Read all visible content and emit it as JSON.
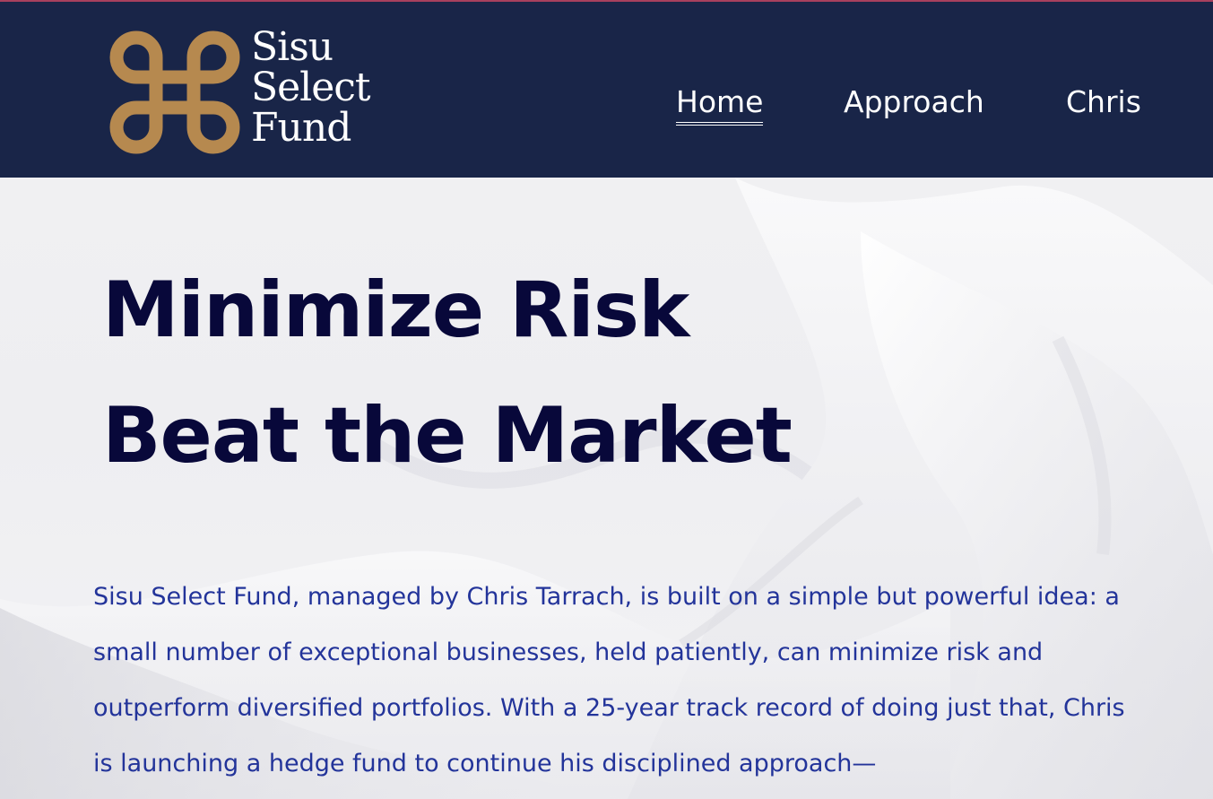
{
  "brand": {
    "name_line1": "Sisu",
    "name_line2": "Select",
    "name_line3": "Fund",
    "logo_color": "#b6894f",
    "header_bg": "#192548"
  },
  "nav": {
    "items": [
      {
        "label": "Home",
        "active": true
      },
      {
        "label": "Approach",
        "active": false
      },
      {
        "label": "Chris",
        "active": false
      }
    ]
  },
  "hero": {
    "headline_line1": "Minimize Risk",
    "headline_line2": "Beat the Market",
    "intro": "Sisu Select Fund, managed by Chris Tarrach, is built on a simple but powerful idea: a small number of exceptional businesses, held patiently, can minimize risk and outperform diversified portfolios. With a 25-year track record of doing just that, Chris is launching a hedge fund to continue his disciplined approach—",
    "headline_color": "#08083a",
    "intro_color": "#23349a"
  }
}
